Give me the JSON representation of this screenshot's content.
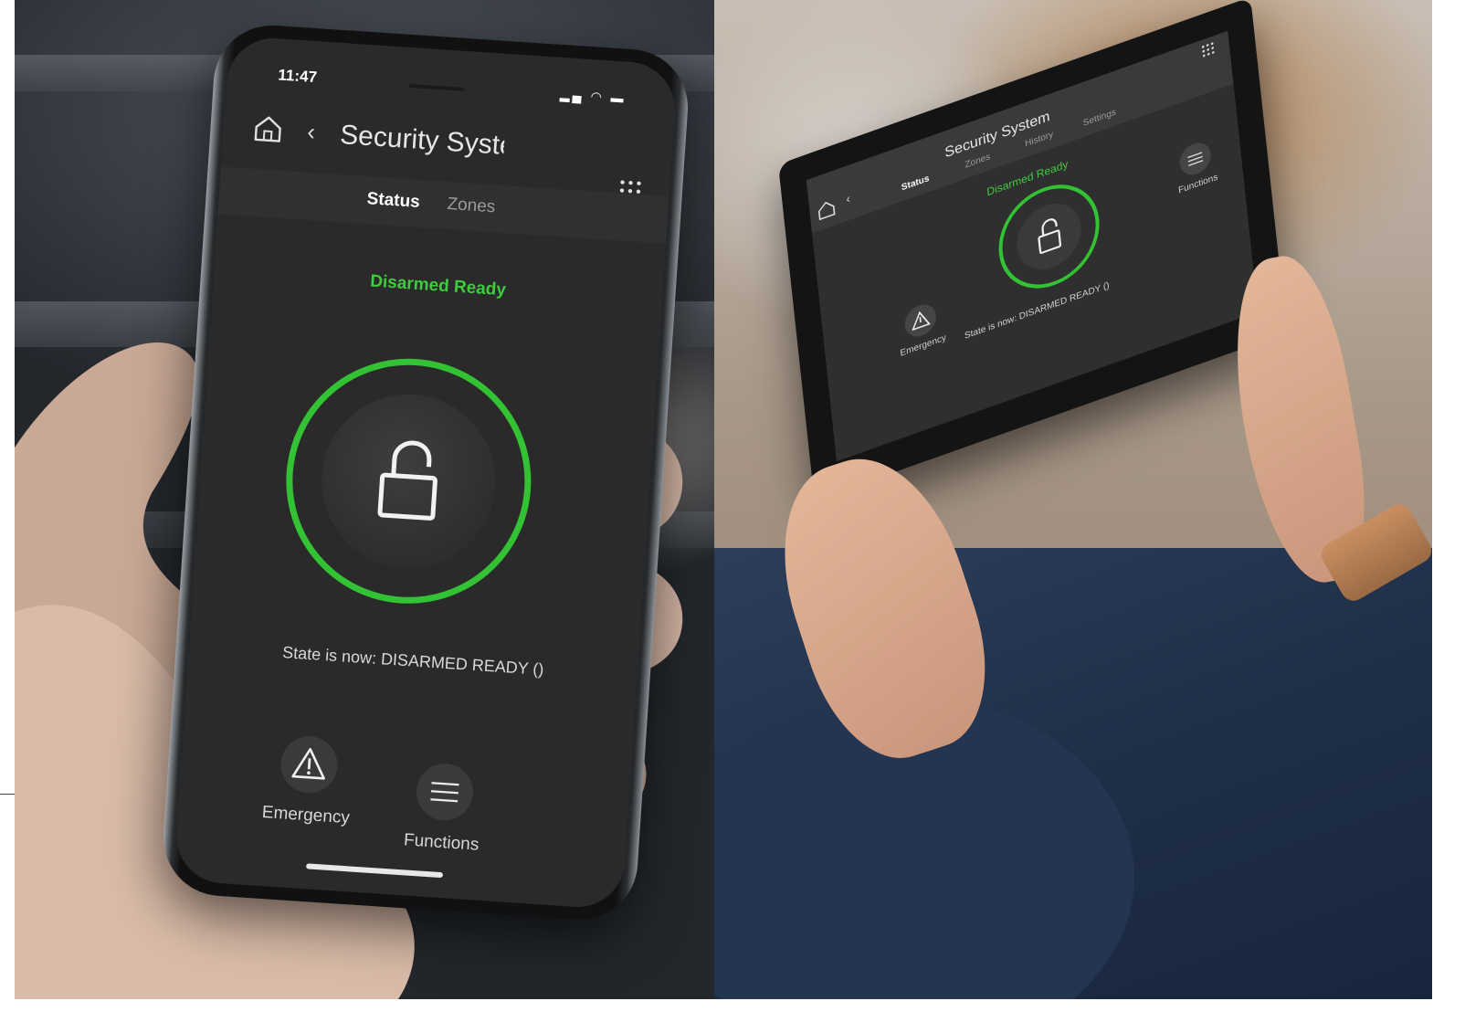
{
  "phone": {
    "status_time": "11:47",
    "title": "Security System",
    "tabs": [
      "Status",
      "Zones"
    ],
    "state_label": "Disarmed Ready",
    "state_message": "State is now: DISARMED READY ()",
    "actions": [
      "Emergency",
      "Functions"
    ]
  },
  "tablet": {
    "title": "Security System",
    "tabs": [
      "Status",
      "Zones",
      "History",
      "Settings"
    ],
    "state_label": "Disarmed Ready",
    "state_message": "State is now: DISARMED READY ()",
    "actions": [
      "Emergency",
      "Functions"
    ]
  },
  "colors": {
    "accent_green": "#33c233",
    "screen_bg": "#2a2a2a"
  },
  "icons": [
    "home-icon",
    "back-chevron-icon",
    "app-grid-icon",
    "unlocked-padlock-icon",
    "warning-triangle-icon",
    "menu-lines-icon"
  ]
}
